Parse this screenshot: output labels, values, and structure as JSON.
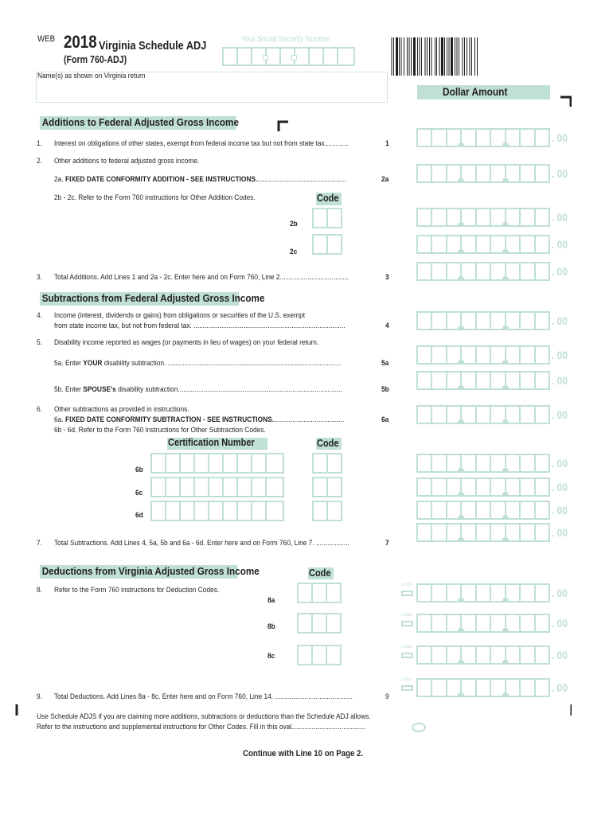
{
  "header": {
    "web_label": "WEB",
    "year": "2018",
    "title": "Virginia Schedule ADJ",
    "form_number": "(Form 760-ADJ)",
    "ssn_label": "Your Social Security Number",
    "name_label": "Name(s) as shown on Virginia return",
    "dollar_amount_label": "Dollar Amount"
  },
  "cents_suffix": ". 00",
  "code_label": "Code",
  "loss_label": "LOSS",
  "additions": {
    "heading": "Additions to Federal Adjusted Gross Income",
    "line1": {
      "num": "1.",
      "text": "Interest on obligations of other states, exempt from federal income tax but not from state tax.............",
      "ref": "1"
    },
    "line2": {
      "num": "2.",
      "text": "Other additions to federal adjusted gross income."
    },
    "line2a": {
      "prefix": "2a.",
      "bold": "FIXED DATE CONFORMITY ADDITION - SEE INSTRUCTIONS.",
      "dots": "................................................",
      "ref": "2a"
    },
    "line2bc_text": "2b - 2c. Refer to the Form 760 instructions for Other Addition Codes.",
    "line2b": "2b",
    "line2c": "2c",
    "line3": {
      "num": "3.",
      "text": "Total Additions. Add Lines 1 and 2a - 2c. Enter here and on Form 760, Line 2.....................................",
      "ref": "3"
    }
  },
  "subtractions": {
    "heading": "Subtractions from Federal Adjusted Gross Income",
    "line4": {
      "num": "4.",
      "text1": "Income (interest, dividends or gains) from obligations or securities of the U.S. exempt",
      "text2": "from state income tax, but not from federal tax. ..................................................................................",
      "ref": "4"
    },
    "line5": {
      "num": "5.",
      "text": "Disability income reported as wages (or payments in lieu of wages) on your federal return."
    },
    "line5a": {
      "prefix": "5a. Enter ",
      "bold": "YOUR",
      "suffix": " disability subtraction. ..............................................................................................",
      "ref": "5a"
    },
    "line5b": {
      "prefix": "5b. Enter ",
      "bold": "SPOUSE's",
      "suffix": " disability subtraction.........................................................................................",
      "ref": "5b"
    },
    "line6": {
      "num": "6.",
      "text": "Other subtractions as provided in instructions."
    },
    "line6a": {
      "prefix": "6a.",
      "bold": "FIXED DATE CONFORMITY SUBTRACTION - SEE INSTRUCTIONS.",
      "dots": "......................................",
      "ref": "6a"
    },
    "line6bd_text": "6b - 6d. Refer to the Form 760 instructions for Other Subtraction Codes.",
    "cert_label": "Certification Number",
    "line6b": "6b",
    "line6c": "6c",
    "line6d": "6d",
    "line7": {
      "num": "7.",
      "text": "Total Subtractions. Add Lines 4, 5a, 5b and 6a - 6d. Enter here and on Form 760, Line 7. ..................",
      "ref": "7"
    }
  },
  "deductions": {
    "heading": "Deductions from Virginia Adjusted Gross Income",
    "line8": {
      "num": "8.",
      "text": "Refer to the Form 760 instructions for Deduction Codes."
    },
    "line8a": "8a",
    "line8b": "8b",
    "line8c": "8c",
    "line9": {
      "num": "9.",
      "text": "Total Deductions. Add Lines 8a - 8c. Enter here and on Form 760, Line 14. ..........................................",
      "ref": "9"
    }
  },
  "footer": {
    "adjs_line1": "Use Schedule ADJS if you are claiming more additions, subtractions or deductions than the Schedule ADJ allows.",
    "adjs_line2": "Refer to the instructions and supplemental instructions for Other Codes. Fill in this oval........................................",
    "continue": "Continue with Line 10 on Page 2."
  },
  "colors": {
    "accent": "#bfe0d3",
    "text": "#231f20"
  }
}
